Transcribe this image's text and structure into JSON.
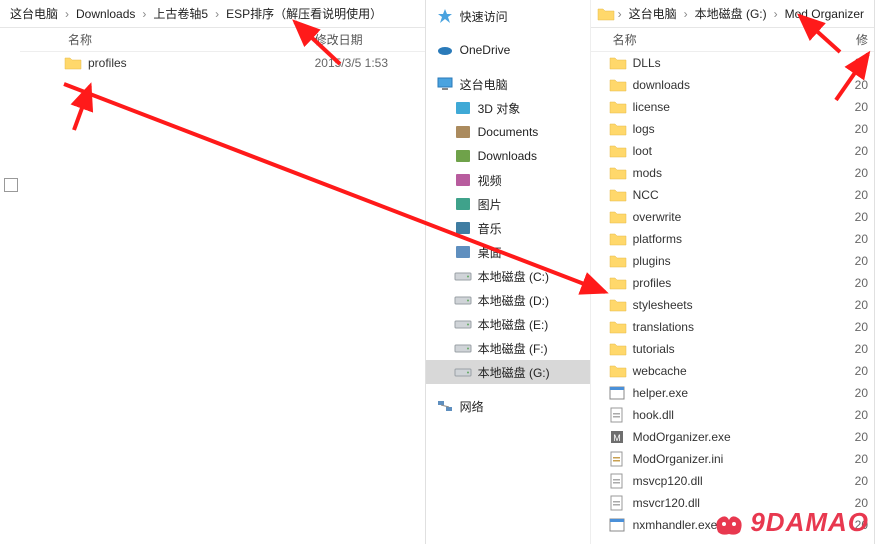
{
  "left": {
    "breadcrumb": [
      "这台电脑",
      "Downloads",
      "上古卷轴5",
      "ESP排序（解压看说明使用）"
    ],
    "headers": {
      "name": "名称",
      "date": "修改日期"
    },
    "rows": [
      {
        "icon": "folder",
        "name": "profiles",
        "date": "2015/3/5 1:53"
      }
    ]
  },
  "right": {
    "breadcrumb": [
      "这台电脑",
      "本地磁盘 (G:)",
      "Mod Organizer"
    ],
    "sidebar": [
      {
        "icon": "quick",
        "label": "快速访问",
        "indent": false
      },
      {
        "icon": "spacer",
        "label": "",
        "indent": false
      },
      {
        "icon": "onedrive",
        "label": "OneDrive",
        "indent": false
      },
      {
        "icon": "spacer",
        "label": "",
        "indent": false
      },
      {
        "icon": "pc",
        "label": "这台电脑",
        "indent": false
      },
      {
        "icon": "3d",
        "label": "3D 对象",
        "indent": true
      },
      {
        "icon": "docs",
        "label": "Documents",
        "indent": true
      },
      {
        "icon": "downloads",
        "label": "Downloads",
        "indent": true
      },
      {
        "icon": "video",
        "label": "视频",
        "indent": true
      },
      {
        "icon": "pictures",
        "label": "图片",
        "indent": true
      },
      {
        "icon": "music",
        "label": "音乐",
        "indent": true
      },
      {
        "icon": "desktop",
        "label": "桌面",
        "indent": true
      },
      {
        "icon": "drive",
        "label": "本地磁盘 (C:)",
        "indent": true
      },
      {
        "icon": "drive",
        "label": "本地磁盘 (D:)",
        "indent": true
      },
      {
        "icon": "drive",
        "label": "本地磁盘 (E:)",
        "indent": true
      },
      {
        "icon": "drive",
        "label": "本地磁盘 (F:)",
        "indent": true
      },
      {
        "icon": "drive",
        "label": "本地磁盘 (G:)",
        "indent": true,
        "selected": true
      },
      {
        "icon": "spacer",
        "label": "",
        "indent": false
      },
      {
        "icon": "network",
        "label": "网络",
        "indent": false
      }
    ],
    "headers": {
      "name": "名称",
      "size": "修"
    },
    "rows": [
      {
        "icon": "folder",
        "name": "DLLs",
        "size": "20"
      },
      {
        "icon": "folder",
        "name": "downloads",
        "size": "20"
      },
      {
        "icon": "folder",
        "name": "license",
        "size": "20"
      },
      {
        "icon": "folder",
        "name": "logs",
        "size": "20"
      },
      {
        "icon": "folder",
        "name": "loot",
        "size": "20"
      },
      {
        "icon": "folder",
        "name": "mods",
        "size": "20"
      },
      {
        "icon": "folder",
        "name": "NCC",
        "size": "20"
      },
      {
        "icon": "folder",
        "name": "overwrite",
        "size": "20"
      },
      {
        "icon": "folder",
        "name": "platforms",
        "size": "20"
      },
      {
        "icon": "folder",
        "name": "plugins",
        "size": "20"
      },
      {
        "icon": "folder",
        "name": "profiles",
        "size": "20"
      },
      {
        "icon": "folder",
        "name": "stylesheets",
        "size": "20"
      },
      {
        "icon": "folder",
        "name": "translations",
        "size": "20"
      },
      {
        "icon": "folder",
        "name": "tutorials",
        "size": "20"
      },
      {
        "icon": "folder",
        "name": "webcache",
        "size": "20"
      },
      {
        "icon": "exe",
        "name": "helper.exe",
        "size": "20"
      },
      {
        "icon": "dll",
        "name": "hook.dll",
        "size": "20"
      },
      {
        "icon": "exe2",
        "name": "ModOrganizer.exe",
        "size": "20"
      },
      {
        "icon": "ini",
        "name": "ModOrganizer.ini",
        "size": "20"
      },
      {
        "icon": "dll",
        "name": "msvcp120.dll",
        "size": "20"
      },
      {
        "icon": "dll",
        "name": "msvcr120.dll",
        "size": "20"
      },
      {
        "icon": "exe",
        "name": "nxmhandler.exe",
        "size": "20"
      }
    ]
  },
  "watermark": "9DAMAO"
}
